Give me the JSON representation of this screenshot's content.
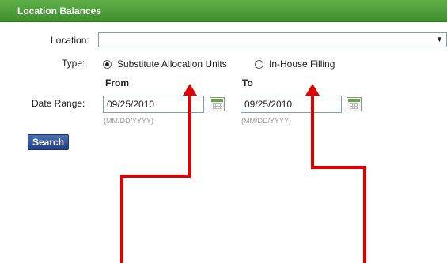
{
  "panel": {
    "title": "Location Balances"
  },
  "form": {
    "location_label": "Location:",
    "type_label": "Type:",
    "type_options": [
      {
        "label": "Substitute Allocation Units",
        "checked": true
      },
      {
        "label": "In-House Filling",
        "checked": false
      }
    ],
    "from_label": "From",
    "to_label": "To",
    "date_range_label": "Date Range:",
    "from_date": "09/25/2010",
    "to_date": "09/25/2010",
    "date_hint": "(MM/DD/YYYY)",
    "search_label": "Search"
  },
  "icons": {
    "dropdown": "chevron-down-icon",
    "calendar": "calendar-icon",
    "annotation": "red-arrow-icon"
  },
  "colors": {
    "header_green": "#3f8f2e",
    "search_blue": "#1f3f86",
    "annotation_red": "#e00000"
  }
}
